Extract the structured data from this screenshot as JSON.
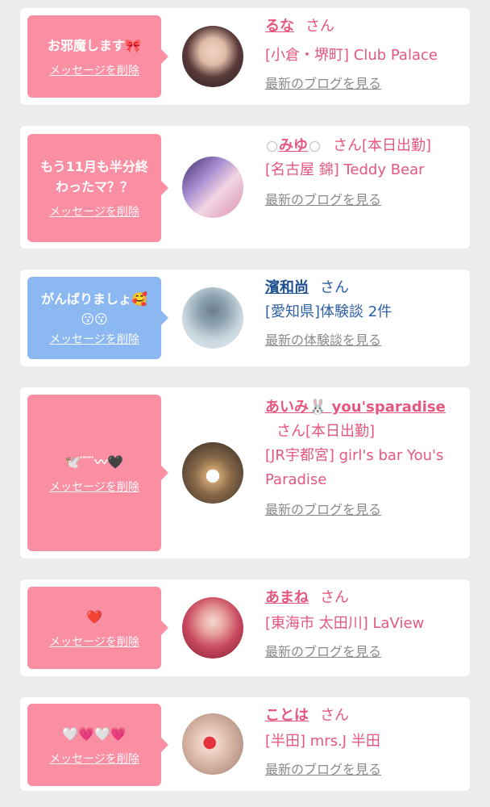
{
  "delete_label": "メッセージを削除",
  "san_label": "さん",
  "items": [
    {
      "message": "お邪魔します🎀",
      "name": "るな",
      "badge": "",
      "shop": "[小倉・堺町] Club Palace",
      "link": "最新のブログを見る",
      "avatar_icon": "photo-avatar"
    },
    {
      "message": "もう11月も半分終\nわったマ？？",
      "name": "みゆ",
      "badge": "[本日出勤]",
      "shop": "[名古屋 錦] Teddy Bear",
      "link": "最新のブログを見る",
      "avatar_icon": "photo-avatar"
    },
    {
      "message": "がんばりましょ🥰\n😗😗",
      "name": "濱和尚",
      "badge": "",
      "shop": "[愛知県]体験談 2件",
      "link": "最新の体験談を見る",
      "avatar_icon": "no-photo-avatar"
    },
    {
      "message": "🕊️ ̈ ̈ ̈〰🖤",
      "name": "あいみ🐰 you'sparadise",
      "badge": "[本日出勤]",
      "shop": "[JR宇都宮] girl's bar You's Paradise",
      "link": "最新のブログを見る",
      "avatar_icon": "photo-avatar"
    },
    {
      "message": "❤️",
      "name": "あまね",
      "badge": "",
      "shop": "[東海市 太田川] LaView",
      "link": "最新のブログを見る",
      "avatar_icon": "photo-avatar"
    },
    {
      "message": "🤍💗🤍💗",
      "name": "ことは",
      "badge": "",
      "shop": "[半田] mrs.J 半田",
      "link": "最新のブログを見る",
      "avatar_icon": "photo-avatar"
    }
  ],
  "colors": {
    "pink_bubble": "#fa8ea2",
    "blue_bubble": "#8cb8f2",
    "name_pink": "#e4577e",
    "name_blue": "#1d4f91"
  }
}
